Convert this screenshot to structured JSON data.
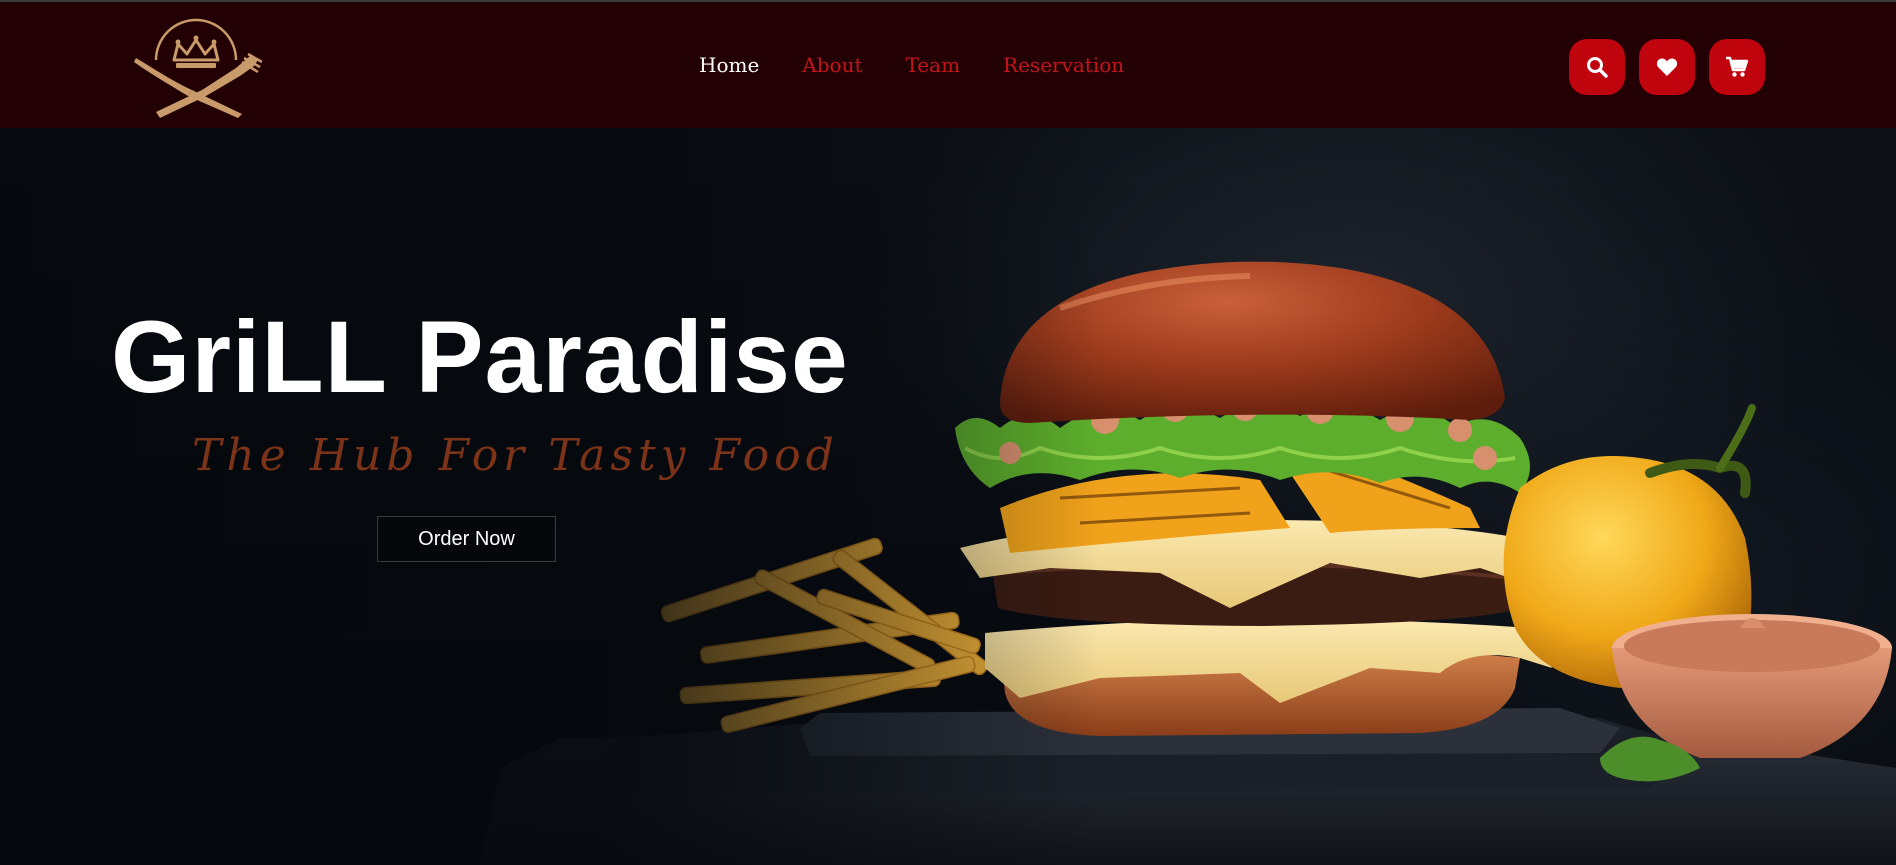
{
  "brand": {
    "logo_icon": "crown-cutlery-logo",
    "logo_color": "#c99a6a"
  },
  "nav": {
    "items": [
      {
        "label": "Home",
        "active": true
      },
      {
        "label": "About",
        "active": false
      },
      {
        "label": "Team",
        "active": false
      },
      {
        "label": "Reservation",
        "active": false
      }
    ],
    "active_color": "#ffffff",
    "link_color": "#c4141c",
    "background": "#230003"
  },
  "actions": {
    "icons": [
      "search-icon",
      "heart-icon",
      "cart-icon"
    ],
    "button_color": "#c0040d"
  },
  "hero": {
    "title": "GriLL Paradise",
    "tagline": "The Hub For Tasty Food",
    "cta_label": "Order Now",
    "tagline_color": "#7c3318"
  }
}
